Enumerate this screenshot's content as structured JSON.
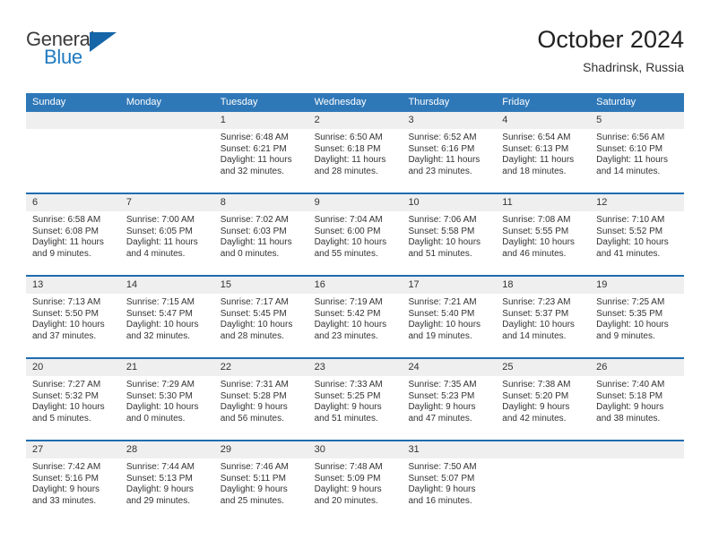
{
  "brand": {
    "name_part1": "General",
    "name_part2": "Blue",
    "triangle_icon": "triangle-icon",
    "accent_color": "#1565a8",
    "blue_text_color": "#1f7ac0"
  },
  "header": {
    "title": "October 2024",
    "location": "Shadrinsk, Russia"
  },
  "theme": {
    "header_blue": "#2f78b8",
    "separator_blue": "#1f6cb0",
    "date_strip_gray": "#efefef",
    "text_color": "#333333"
  },
  "weekdays": [
    "Sunday",
    "Monday",
    "Tuesday",
    "Wednesday",
    "Thursday",
    "Friday",
    "Saturday"
  ],
  "weeks": [
    {
      "days": [
        {
          "num": "",
          "sunrise": "",
          "sunset": "",
          "daylight1": "",
          "daylight2": ""
        },
        {
          "num": "",
          "sunrise": "",
          "sunset": "",
          "daylight1": "",
          "daylight2": ""
        },
        {
          "num": "1",
          "sunrise": "Sunrise: 6:48 AM",
          "sunset": "Sunset: 6:21 PM",
          "daylight1": "Daylight: 11 hours",
          "daylight2": "and 32 minutes."
        },
        {
          "num": "2",
          "sunrise": "Sunrise: 6:50 AM",
          "sunset": "Sunset: 6:18 PM",
          "daylight1": "Daylight: 11 hours",
          "daylight2": "and 28 minutes."
        },
        {
          "num": "3",
          "sunrise": "Sunrise: 6:52 AM",
          "sunset": "Sunset: 6:16 PM",
          "daylight1": "Daylight: 11 hours",
          "daylight2": "and 23 minutes."
        },
        {
          "num": "4",
          "sunrise": "Sunrise: 6:54 AM",
          "sunset": "Sunset: 6:13 PM",
          "daylight1": "Daylight: 11 hours",
          "daylight2": "and 18 minutes."
        },
        {
          "num": "5",
          "sunrise": "Sunrise: 6:56 AM",
          "sunset": "Sunset: 6:10 PM",
          "daylight1": "Daylight: 11 hours",
          "daylight2": "and 14 minutes."
        }
      ]
    },
    {
      "days": [
        {
          "num": "6",
          "sunrise": "Sunrise: 6:58 AM",
          "sunset": "Sunset: 6:08 PM",
          "daylight1": "Daylight: 11 hours",
          "daylight2": "and 9 minutes."
        },
        {
          "num": "7",
          "sunrise": "Sunrise: 7:00 AM",
          "sunset": "Sunset: 6:05 PM",
          "daylight1": "Daylight: 11 hours",
          "daylight2": "and 4 minutes."
        },
        {
          "num": "8",
          "sunrise": "Sunrise: 7:02 AM",
          "sunset": "Sunset: 6:03 PM",
          "daylight1": "Daylight: 11 hours",
          "daylight2": "and 0 minutes."
        },
        {
          "num": "9",
          "sunrise": "Sunrise: 7:04 AM",
          "sunset": "Sunset: 6:00 PM",
          "daylight1": "Daylight: 10 hours",
          "daylight2": "and 55 minutes."
        },
        {
          "num": "10",
          "sunrise": "Sunrise: 7:06 AM",
          "sunset": "Sunset: 5:58 PM",
          "daylight1": "Daylight: 10 hours",
          "daylight2": "and 51 minutes."
        },
        {
          "num": "11",
          "sunrise": "Sunrise: 7:08 AM",
          "sunset": "Sunset: 5:55 PM",
          "daylight1": "Daylight: 10 hours",
          "daylight2": "and 46 minutes."
        },
        {
          "num": "12",
          "sunrise": "Sunrise: 7:10 AM",
          "sunset": "Sunset: 5:52 PM",
          "daylight1": "Daylight: 10 hours",
          "daylight2": "and 41 minutes."
        }
      ]
    },
    {
      "days": [
        {
          "num": "13",
          "sunrise": "Sunrise: 7:13 AM",
          "sunset": "Sunset: 5:50 PM",
          "daylight1": "Daylight: 10 hours",
          "daylight2": "and 37 minutes."
        },
        {
          "num": "14",
          "sunrise": "Sunrise: 7:15 AM",
          "sunset": "Sunset: 5:47 PM",
          "daylight1": "Daylight: 10 hours",
          "daylight2": "and 32 minutes."
        },
        {
          "num": "15",
          "sunrise": "Sunrise: 7:17 AM",
          "sunset": "Sunset: 5:45 PM",
          "daylight1": "Daylight: 10 hours",
          "daylight2": "and 28 minutes."
        },
        {
          "num": "16",
          "sunrise": "Sunrise: 7:19 AM",
          "sunset": "Sunset: 5:42 PM",
          "daylight1": "Daylight: 10 hours",
          "daylight2": "and 23 minutes."
        },
        {
          "num": "17",
          "sunrise": "Sunrise: 7:21 AM",
          "sunset": "Sunset: 5:40 PM",
          "daylight1": "Daylight: 10 hours",
          "daylight2": "and 19 minutes."
        },
        {
          "num": "18",
          "sunrise": "Sunrise: 7:23 AM",
          "sunset": "Sunset: 5:37 PM",
          "daylight1": "Daylight: 10 hours",
          "daylight2": "and 14 minutes."
        },
        {
          "num": "19",
          "sunrise": "Sunrise: 7:25 AM",
          "sunset": "Sunset: 5:35 PM",
          "daylight1": "Daylight: 10 hours",
          "daylight2": "and 9 minutes."
        }
      ]
    },
    {
      "days": [
        {
          "num": "20",
          "sunrise": "Sunrise: 7:27 AM",
          "sunset": "Sunset: 5:32 PM",
          "daylight1": "Daylight: 10 hours",
          "daylight2": "and 5 minutes."
        },
        {
          "num": "21",
          "sunrise": "Sunrise: 7:29 AM",
          "sunset": "Sunset: 5:30 PM",
          "daylight1": "Daylight: 10 hours",
          "daylight2": "and 0 minutes."
        },
        {
          "num": "22",
          "sunrise": "Sunrise: 7:31 AM",
          "sunset": "Sunset: 5:28 PM",
          "daylight1": "Daylight: 9 hours",
          "daylight2": "and 56 minutes."
        },
        {
          "num": "23",
          "sunrise": "Sunrise: 7:33 AM",
          "sunset": "Sunset: 5:25 PM",
          "daylight1": "Daylight: 9 hours",
          "daylight2": "and 51 minutes."
        },
        {
          "num": "24",
          "sunrise": "Sunrise: 7:35 AM",
          "sunset": "Sunset: 5:23 PM",
          "daylight1": "Daylight: 9 hours",
          "daylight2": "and 47 minutes."
        },
        {
          "num": "25",
          "sunrise": "Sunrise: 7:38 AM",
          "sunset": "Sunset: 5:20 PM",
          "daylight1": "Daylight: 9 hours",
          "daylight2": "and 42 minutes."
        },
        {
          "num": "26",
          "sunrise": "Sunrise: 7:40 AM",
          "sunset": "Sunset: 5:18 PM",
          "daylight1": "Daylight: 9 hours",
          "daylight2": "and 38 minutes."
        }
      ]
    },
    {
      "days": [
        {
          "num": "27",
          "sunrise": "Sunrise: 7:42 AM",
          "sunset": "Sunset: 5:16 PM",
          "daylight1": "Daylight: 9 hours",
          "daylight2": "and 33 minutes."
        },
        {
          "num": "28",
          "sunrise": "Sunrise: 7:44 AM",
          "sunset": "Sunset: 5:13 PM",
          "daylight1": "Daylight: 9 hours",
          "daylight2": "and 29 minutes."
        },
        {
          "num": "29",
          "sunrise": "Sunrise: 7:46 AM",
          "sunset": "Sunset: 5:11 PM",
          "daylight1": "Daylight: 9 hours",
          "daylight2": "and 25 minutes."
        },
        {
          "num": "30",
          "sunrise": "Sunrise: 7:48 AM",
          "sunset": "Sunset: 5:09 PM",
          "daylight1": "Daylight: 9 hours",
          "daylight2": "and 20 minutes."
        },
        {
          "num": "31",
          "sunrise": "Sunrise: 7:50 AM",
          "sunset": "Sunset: 5:07 PM",
          "daylight1": "Daylight: 9 hours",
          "daylight2": "and 16 minutes."
        },
        {
          "num": "",
          "sunrise": "",
          "sunset": "",
          "daylight1": "",
          "daylight2": ""
        },
        {
          "num": "",
          "sunrise": "",
          "sunset": "",
          "daylight1": "",
          "daylight2": ""
        }
      ]
    }
  ]
}
